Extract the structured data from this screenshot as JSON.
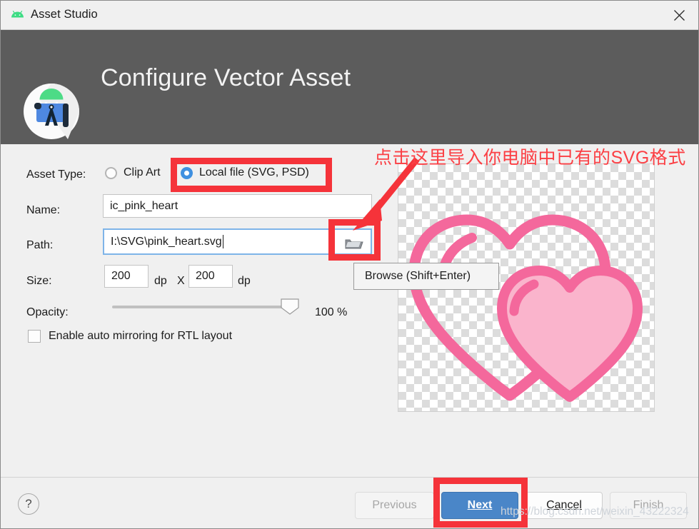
{
  "window": {
    "title": "Asset Studio",
    "app_icon": "android-icon",
    "close_icon": "close-icon"
  },
  "header": {
    "title": "Configure Vector Asset",
    "logo_icon": "android-studio-logo"
  },
  "form": {
    "asset_type": {
      "label": "Asset Type:",
      "options": [
        {
          "label": "Clip Art",
          "selected": false
        },
        {
          "label": "Local file (SVG, PSD)",
          "selected": true
        }
      ]
    },
    "name": {
      "label": "Name:",
      "value": "ic_pink_heart"
    },
    "path": {
      "label": "Path:",
      "value": "I:\\SVG\\pink_heart.svg",
      "browse_icon": "folder-open-icon",
      "browse_tooltip": "Browse (Shift+Enter)"
    },
    "size": {
      "label": "Size:",
      "width_value": "200",
      "width_unit": "dp",
      "separator": "X",
      "height_value": "200",
      "height_unit": "dp"
    },
    "opacity": {
      "label": "Opacity:",
      "value": 100,
      "display": "100 %"
    },
    "mirroring": {
      "label": "Enable auto mirroring for RTL layout",
      "checked": false
    }
  },
  "preview": {
    "name": "vector-preview",
    "stroke_color": "#f4689c",
    "fill_color": "#fab4cc"
  },
  "footer": {
    "help_label": "?",
    "buttons": [
      {
        "label": "Previous",
        "state": "disabled",
        "mnemonic": ""
      },
      {
        "label": "Next",
        "state": "primary",
        "mnemonic": "N"
      },
      {
        "label": "Cancel",
        "state": "normal",
        "mnemonic": "C"
      },
      {
        "label": "Finish",
        "state": "disabled",
        "mnemonic": ""
      }
    ]
  },
  "annotations": {
    "callout_text": "点击这里导入你电脑中已有的SVG格式",
    "accent_color": "#f5333a",
    "watermark": "https://blog.csdn.net/weixin_43222324"
  }
}
